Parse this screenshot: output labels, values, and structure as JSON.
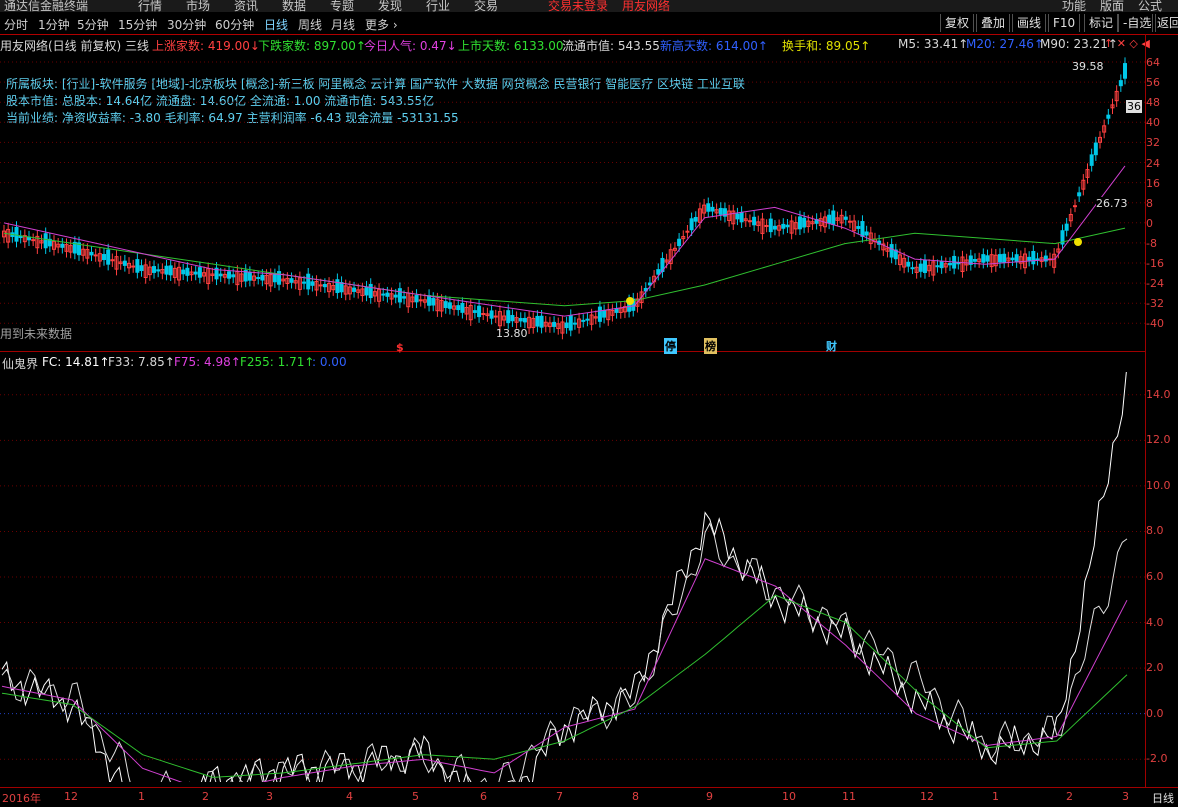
{
  "top_menu": {
    "app_title": "通达信金融终端",
    "items": [
      "行情",
      "市场",
      "资讯",
      "数据",
      "专题",
      "发现",
      "行业",
      "交易"
    ],
    "login_status": "交易未登录",
    "user_label": "用友网络",
    "right_items": [
      "功能",
      "版面",
      "公式"
    ]
  },
  "toolbar": {
    "periods": [
      "分时",
      "1分钟",
      "5分钟",
      "15分钟",
      "30分钟",
      "60分钟",
      "日线",
      "周线",
      "月线",
      "更多 ›"
    ],
    "active_period": "日线",
    "right_buttons": [
      "复权",
      "叠加",
      "画线",
      "F10",
      "标记",
      "-自选",
      "返回"
    ]
  },
  "info_bar": {
    "stock_title": "用友网络(日线 前复权) 三线",
    "up_count_label": "上涨家数: 419.00↓",
    "down_count_label": "下跌家数: 897.00↑",
    "popularity_label": "今日人气: 0.47↓",
    "listed_days_label": "上市天数: 6133.00",
    "float_mv_label": "流通市值: 543.55",
    "new_high_days_label": "新高天数: 614.00↑",
    "turnover_sum_label": "换手和: 89.05↑",
    "ma5": "M5: 33.41↑",
    "ma20": "M20: 27.46↑",
    "ma90": "M90: 23.21↑"
  },
  "f10_info": {
    "line1": "所属板块: [行业]-软件服务 [地域]-北京板块 [概念]-新三板 阿里概念 云计算 国产软件 大数据 网贷概念 民营银行 智能医疗 区块链 工业互联",
    "line2": "股本市值: 总股本: 14.64亿 流通盘: 14.60亿 全流通: 1.00 流通市值: 543.55亿",
    "line3": "当前业绩: 净资收益率: -3.80 毛利率: 64.97 主营利润率 -6.43 现金流量 -53131.55"
  },
  "price_pane": {
    "future_data_note": "用到未来数据",
    "high_label": "39.58",
    "low_label": "13.80",
    "mid_label": "26.73",
    "cursor_price": "36",
    "axis_ticks": [
      "64",
      "56",
      "48",
      "40",
      "32",
      "24",
      "16",
      "8",
      "0",
      "-8",
      "-16",
      "-24",
      "-32",
      "-40"
    ],
    "event_markers": [
      "$",
      "停",
      "榜",
      "财"
    ]
  },
  "indicator_pane": {
    "name": "仙鬼界",
    "fc": "FC: 14.81↑",
    "f33": "F33: 7.85↑",
    "f75": "F75: 4.98↑",
    "f255": "F255: 1.71↑",
    "extra": ": 0.00",
    "axis_ticks": [
      "14.0",
      "12.0",
      "10.0",
      "8.0",
      "6.0",
      "4.0",
      "2.0",
      "0.0",
      "-2.0"
    ]
  },
  "time_axis": {
    "labels": [
      "2016年",
      "12",
      "1",
      "2",
      "3",
      "4",
      "5",
      "6",
      "7",
      "8",
      "9",
      "10",
      "11",
      "12",
      "1",
      "2",
      "3"
    ],
    "right_label": "日线"
  },
  "colors": {
    "up": "#ff4040",
    "down": "#00c8e8",
    "ma_pink": "#d040d0",
    "ma_green": "#30c030",
    "grid": "#a00000",
    "white": "#ffffff"
  },
  "chart_data": {
    "type": "line",
    "title": "仙鬼界",
    "x": [
      "2016-11",
      "2016-12",
      "2017-01",
      "2017-02",
      "2017-03",
      "2017-04",
      "2017-05",
      "2017-06",
      "2017-07",
      "2017-08",
      "2017-09",
      "2017-10",
      "2017-11",
      "2017-12",
      "2018-01",
      "2018-02",
      "2018-03"
    ],
    "series": [
      {
        "name": "FC",
        "values": [
          1.6,
          0.4,
          -4.5,
          -3.0,
          -2.4,
          -2.3,
          -1.6,
          -4.4,
          -0.6,
          1.0,
          8.5,
          5.0,
          3.4,
          0.6,
          -1.6,
          -1.0,
          14.8
        ]
      },
      {
        "name": "F33",
        "values": [
          1.5,
          0.8,
          -3.5,
          -3.2,
          -2.6,
          -2.2,
          -1.9,
          -3.3,
          -0.4,
          0.6,
          7.6,
          5.4,
          3.8,
          1.6,
          -1.4,
          -0.8,
          7.85
        ]
      },
      {
        "name": "F75",
        "values": [
          1.2,
          0.6,
          -2.4,
          -3.5,
          -2.8,
          -2.3,
          -2.0,
          -2.6,
          -0.6,
          0.2,
          6.8,
          5.6,
          3.0,
          0.0,
          -1.4,
          -1.0,
          4.98
        ]
      },
      {
        "name": "F255",
        "values": [
          0.9,
          0.4,
          -1.8,
          -2.8,
          -2.6,
          -2.2,
          -1.8,
          -2.0,
          -1.2,
          0.3,
          2.6,
          5.2,
          4.0,
          1.0,
          -1.5,
          -1.2,
          1.71
        ]
      }
    ],
    "ylim": [
      -3,
      15
    ]
  },
  "price_chart_data": {
    "type": "line",
    "ma20": [
      2,
      -4,
      -10,
      -16,
      -18,
      -22,
      -26,
      -30,
      -34,
      -30,
      4,
      8,
      0,
      -12,
      -14,
      -12,
      24
    ],
    "ma90": [
      -2,
      -6,
      -10,
      -14,
      -18,
      -22,
      -26,
      -28,
      -30,
      -28,
      -22,
      -14,
      -6,
      -2,
      -4,
      -6,
      0
    ],
    "close": [
      -2,
      -8,
      -16,
      -18,
      -20,
      -24,
      -28,
      -34,
      -38,
      -30,
      8,
      0,
      4,
      -16,
      -12,
      -12,
      60
    ],
    "ylim": [
      -44,
      68
    ]
  }
}
